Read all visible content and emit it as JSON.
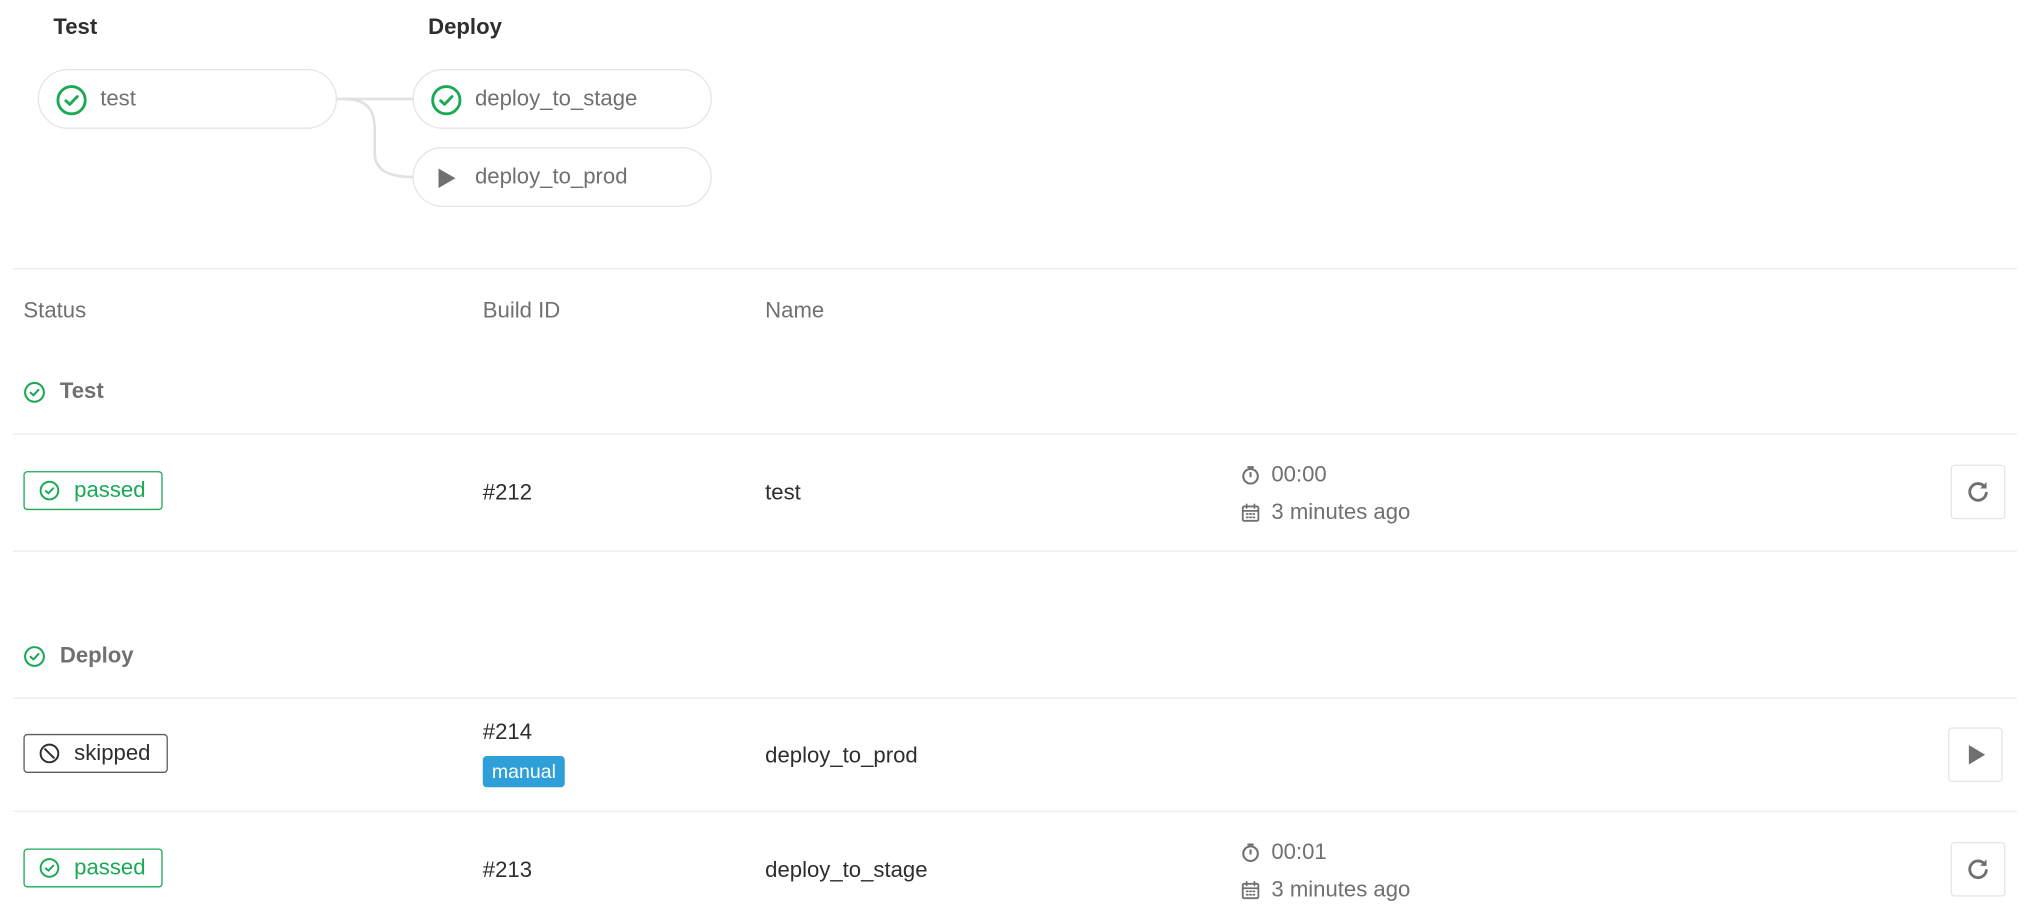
{
  "pipeline_graph": {
    "stages": [
      {
        "title": "Test",
        "jobs": [
          {
            "name": "test",
            "status": "passed"
          }
        ]
      },
      {
        "title": "Deploy",
        "jobs": [
          {
            "name": "deploy_to_stage",
            "status": "passed"
          },
          {
            "name": "deploy_to_prod",
            "status": "manual"
          }
        ]
      }
    ]
  },
  "table": {
    "headers": {
      "status": "Status",
      "build_id": "Build ID",
      "name": "Name"
    },
    "groups": [
      {
        "title": "Test",
        "rows": [
          {
            "status": "passed",
            "build_id": "#212",
            "name": "test",
            "duration": "00:00",
            "finished": "3 minutes ago",
            "action": "retry"
          }
        ]
      },
      {
        "title": "Deploy",
        "rows": [
          {
            "status": "skipped",
            "build_id": "#214",
            "tag": "manual",
            "name": "deploy_to_prod",
            "action": "play"
          },
          {
            "status": "passed",
            "build_id": "#213",
            "name": "deploy_to_stage",
            "duration": "00:01",
            "finished": "3 minutes ago",
            "action": "retry"
          }
        ]
      }
    ]
  },
  "colors": {
    "success": "#1aaa55",
    "manual_tag": "#2e9fd8",
    "muted_text": "#707070"
  }
}
